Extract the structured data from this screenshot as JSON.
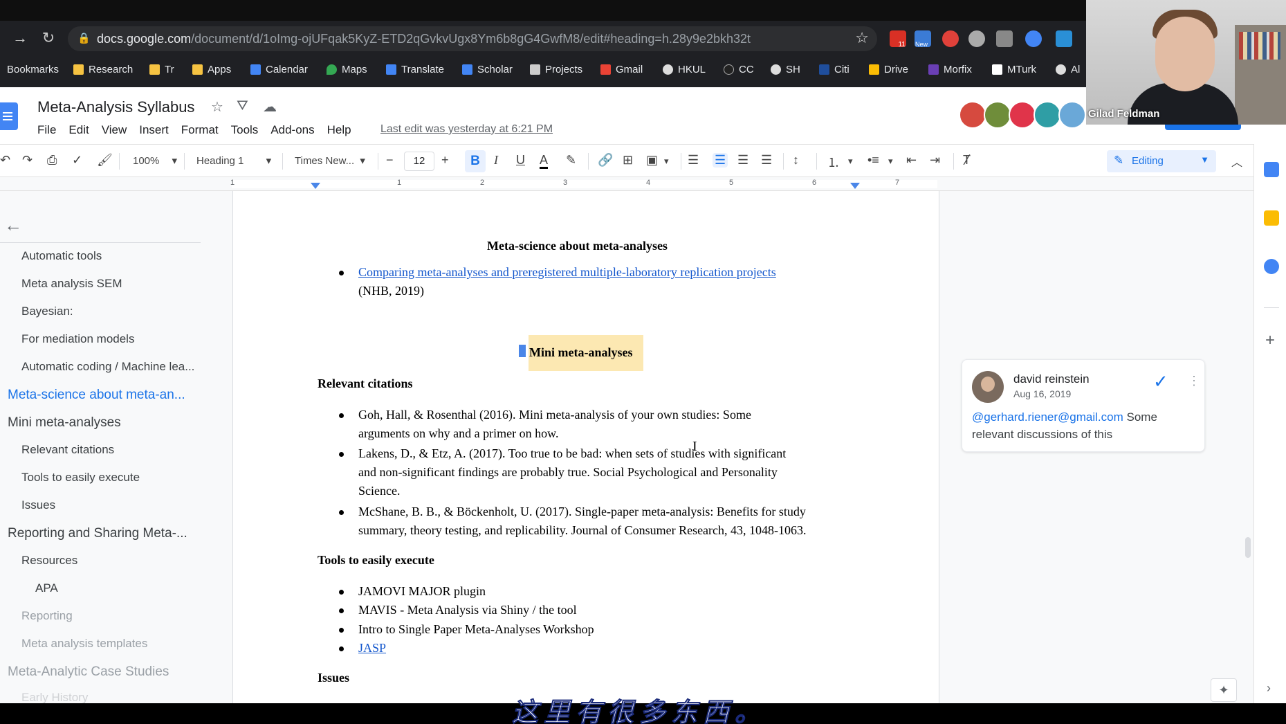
{
  "browser": {
    "url_domain": "docs.google.com",
    "url_path": "/document/d/1oImg-ojUFqak5KyZ-ETD2qGvkvUgx8Ym6b8gG4GwfM8/edit#heading=h.28y9e2bkh32t",
    "extension_badges": [
      "11",
      "New"
    ],
    "bookmarks": [
      "Bookmarks",
      "Research",
      "Tr",
      "Apps",
      "Calendar",
      "Maps",
      "Translate",
      "Scholar",
      "Projects",
      "Gmail",
      "HKUL",
      "CC",
      "SH",
      "Citi",
      "Drive",
      "Morfix",
      "MTurk",
      "Al"
    ]
  },
  "docs": {
    "title": "Meta-Analysis Syllabus",
    "menu": [
      "File",
      "Edit",
      "View",
      "Insert",
      "Format",
      "Tools",
      "Add-ons",
      "Help"
    ],
    "last_edit": "Last edit was yesterday at 6:21 PM"
  },
  "toolbar": {
    "zoom": "100%",
    "style": "Heading 1",
    "font": "Times New...",
    "font_size": "12",
    "mode": "Editing"
  },
  "ruler": {
    "numbers": [
      "1",
      "1",
      "2",
      "3",
      "4",
      "5",
      "6",
      "7"
    ]
  },
  "outline": {
    "items": [
      {
        "label": "Automatic tools",
        "level": 2,
        "state": "normal"
      },
      {
        "label": "Meta analysis SEM",
        "level": 2,
        "state": "normal"
      },
      {
        "label": "Bayesian:",
        "level": 2,
        "state": "normal"
      },
      {
        "label": "For mediation models",
        "level": 2,
        "state": "normal"
      },
      {
        "label": "Automatic coding / Machine lea...",
        "level": 2,
        "state": "normal"
      },
      {
        "label": "Meta-science about meta-an...",
        "level": 1,
        "state": "active"
      },
      {
        "label": "Mini meta-analyses",
        "level": 1,
        "state": "normal"
      },
      {
        "label": "Relevant citations",
        "level": 2,
        "state": "normal"
      },
      {
        "label": "Tools to easily execute",
        "level": 2,
        "state": "normal"
      },
      {
        "label": "Issues",
        "level": 2,
        "state": "normal"
      },
      {
        "label": "Reporting and Sharing Meta-...",
        "level": 1,
        "state": "normal"
      },
      {
        "label": "Resources",
        "level": 2,
        "state": "normal"
      },
      {
        "label": "APA",
        "level": 3,
        "state": "normal"
      },
      {
        "label": "Reporting",
        "level": 2,
        "state": "faded"
      },
      {
        "label": "Meta analysis templates",
        "level": 2,
        "state": "faded"
      },
      {
        "label": "Meta-Analytic Case Studies",
        "level": 1,
        "state": "faded"
      },
      {
        "label": "Early History",
        "level": 2,
        "state": "faded"
      }
    ]
  },
  "document": {
    "heading_meta_science": "Meta-science about meta-analyses",
    "meta_link": "Comparing meta-analyses and preregistered multiple-laboratory replication projects",
    "meta_source": "(NHB, 2019)",
    "heading_mini": "Mini meta-analyses",
    "relevant_citations": "Relevant citations",
    "citations": [
      [
        "Goh, Hall, & Rosenthal (2016).  Mini meta-analysis of your own studies: Some",
        "arguments on why and a primer on how."
      ],
      [
        "Lakens, D., & Etz, A. (2017). Too true to be bad: when sets of studies with significant",
        "and non-significant findings are probably true. Social Psychological and Personality",
        "Science."
      ],
      [
        "McShane, B. B., & Böckenholt, U. (2017). Single-paper meta-analysis: Benefits for study",
        "summary, theory testing, and replicability. Journal of Consumer Research, 43, 1048-1063."
      ]
    ],
    "tools_heading": "Tools to easily execute",
    "tools": [
      "JAMOVI MAJOR plugin",
      "MAVIS - Meta Analysis via Shiny / the tool",
      "Intro to Single Paper Meta-Analyses Workshop",
      "JASP"
    ],
    "issues_heading": "Issues"
  },
  "comment": {
    "author": "david reinstein",
    "date": "Aug 16, 2019",
    "mention": "@gerhard.riener@gmail.com",
    "text": " Some relevant discussions of this"
  },
  "webcam": {
    "name": "Gilad Feldman"
  },
  "subtitle": "这里有很多东西。",
  "colors": {
    "accent": "#1a73e8",
    "link": "#1155cc",
    "highlight": "#fce8b2"
  }
}
